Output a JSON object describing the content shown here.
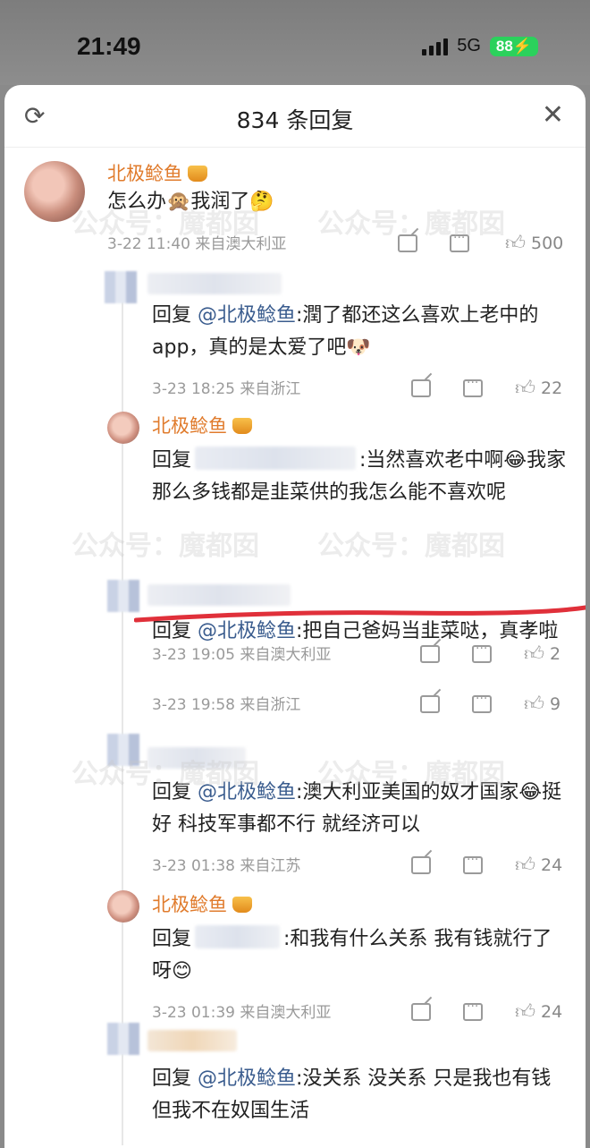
{
  "status": {
    "time": "21:49",
    "network": "5G",
    "battery": "88"
  },
  "header": {
    "title": "834 条回复"
  },
  "main_comment": {
    "name": "北极鲶鱼",
    "text": "怎么办🙊我润了🤔",
    "date": "3-22 11:40",
    "location": "来自澳大利亚",
    "likes": "500"
  },
  "replies": [
    {
      "name_blurred": true,
      "text_prefix": "回复 ",
      "mention": "@北极鲶鱼",
      "text": ":潤了都还这么喜欢上老中的 app，真的是太爱了吧🐶",
      "date": "3-23 18:25",
      "location": "来自浙江",
      "likes": "22"
    },
    {
      "name": "北极鲶鱼",
      "text_prefix": "回复",
      "text": ":当然喜欢老中啊😂我家那么多钱都是韭菜供的我怎么能不喜欢呢",
      "date": "3-23 19:05",
      "location": "来自澳大利亚",
      "likes": "2"
    },
    {
      "name_blurred": true,
      "text_prefix": "回复 ",
      "mention": "@北极鲶鱼",
      "text": ":把自己爸妈当韭菜哒，真孝啦",
      "date": "3-23 19:58",
      "location": "来自浙江",
      "likes": "9"
    },
    {
      "name_blurred": true,
      "text_prefix": "回复 ",
      "mention": "@北极鲶鱼",
      "text": ":澳大利亚美国的奴才国家😂挺好 科技军事都不行 就经济可以",
      "date": "3-23 01:38",
      "location": "来自江苏",
      "likes": "24"
    },
    {
      "name": "北极鲶鱼",
      "text_prefix": "回复",
      "text": ":和我有什么关系 我有钱就行了呀😊",
      "date": "3-23 01:39",
      "location": "来自澳大利亚",
      "likes": "24"
    },
    {
      "name_blurred": true,
      "text_prefix": "回复 ",
      "mention": "@北极鲶鱼",
      "text": ":没关系 没关系 只是我也有钱 但我不在奴国生活"
    }
  ],
  "watermark": "公众号：魔都囡",
  "colors": {
    "name": "#e07b2c",
    "mention": "#3a5c8e",
    "meta": "#9a9a9a",
    "underline": "#e0303a"
  }
}
